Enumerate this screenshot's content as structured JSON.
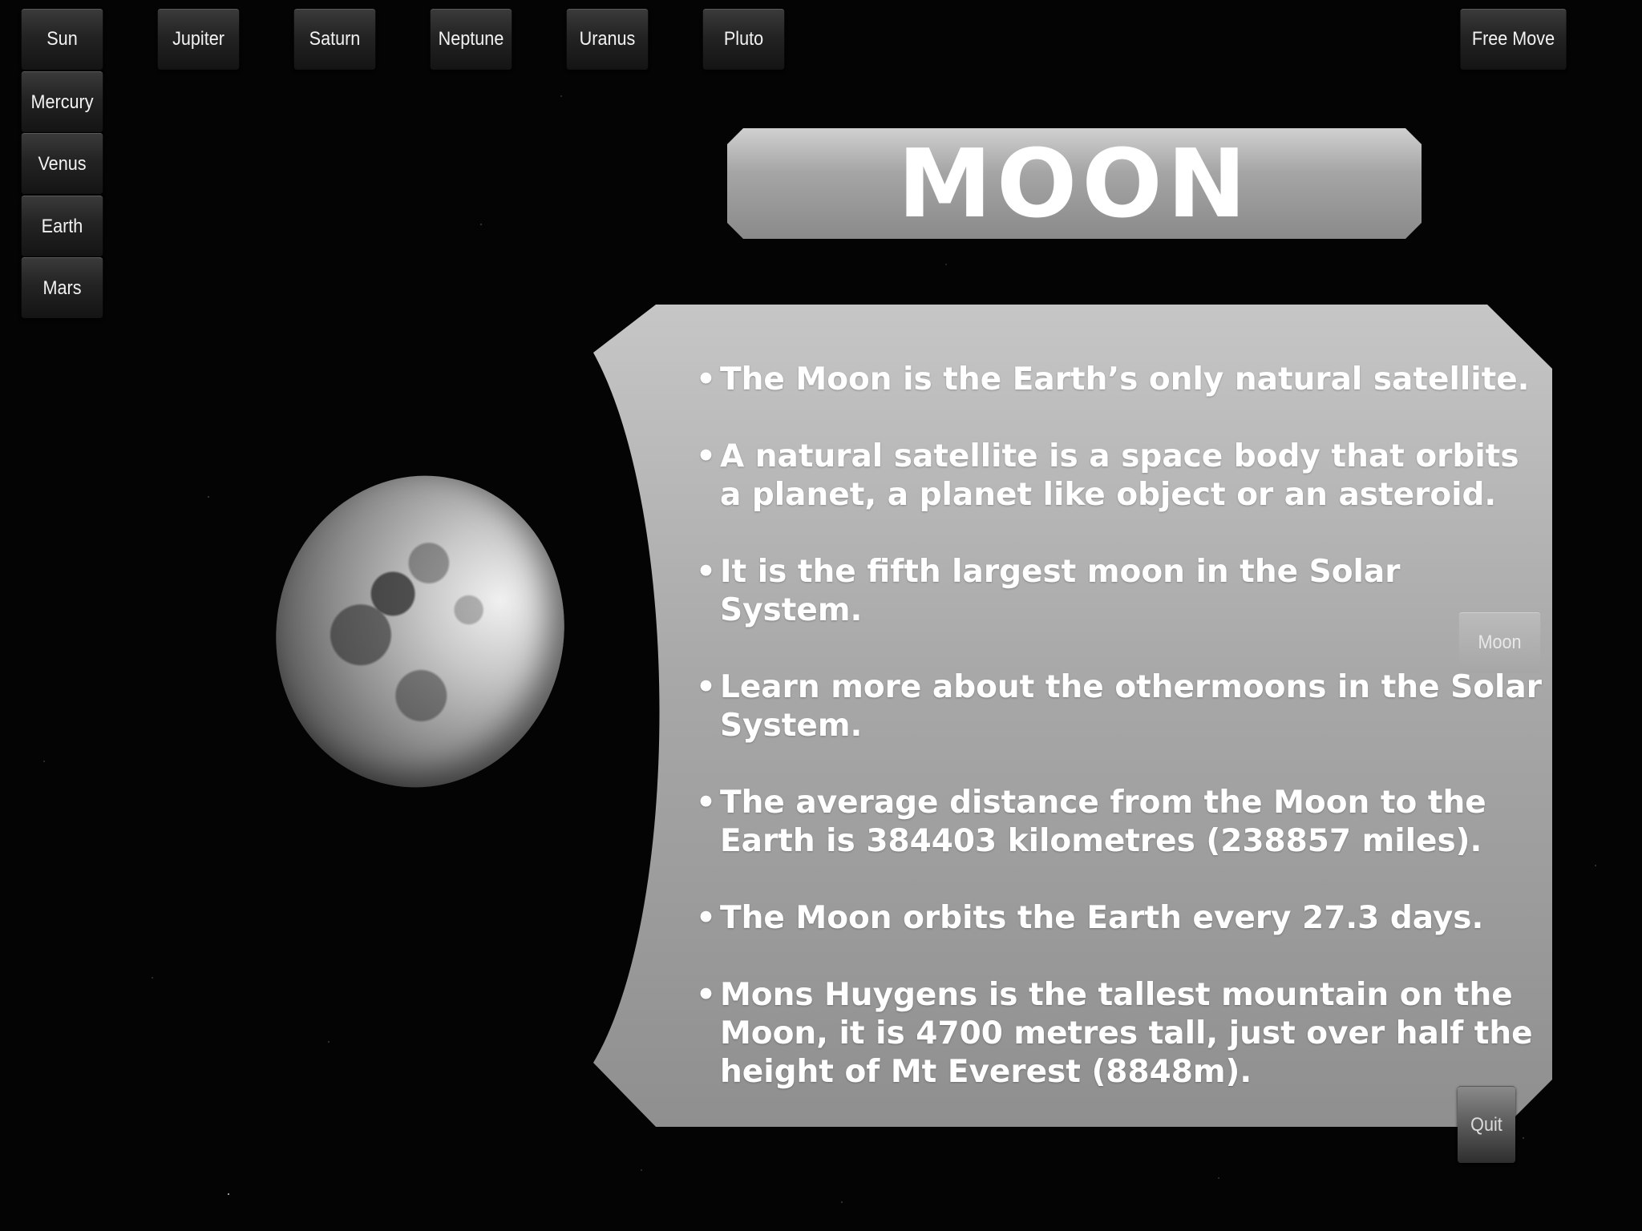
{
  "nav": {
    "sun": "Sun",
    "jupiter": "Jupiter",
    "saturn": "Saturn",
    "neptune": "Neptune",
    "uranus": "Uranus",
    "pluto": "Pluto",
    "mercury": "Mercury",
    "venus": "Venus",
    "earth": "Earth",
    "mars": "Mars",
    "free_move": "Free Move"
  },
  "title": "MOON",
  "facts": [
    "The Moon is the Earth’s only natural satellite.",
    "A natural satellite is a space body that orbits a planet, a planet like object or an asteroid.",
    "It is the fifth largest moon in the Solar System.",
    "Learn more about the othermoons in the Solar System.",
    "The average distance from the Moon to the Earth is 384403 kilometres (238857 miles).",
    "The Moon orbits the Earth every 27.3 days.",
    "Mons Huygens is the tallest mountain on the Moon, it is 4700 metres tall, just over half the height of Mt Everest (8848m)."
  ],
  "moon_button": "Moon",
  "quit_button": "Quit",
  "colors": {
    "background": "#040404",
    "panel": "#a8a8a8",
    "text": "#ffffff",
    "button": "#232323"
  }
}
